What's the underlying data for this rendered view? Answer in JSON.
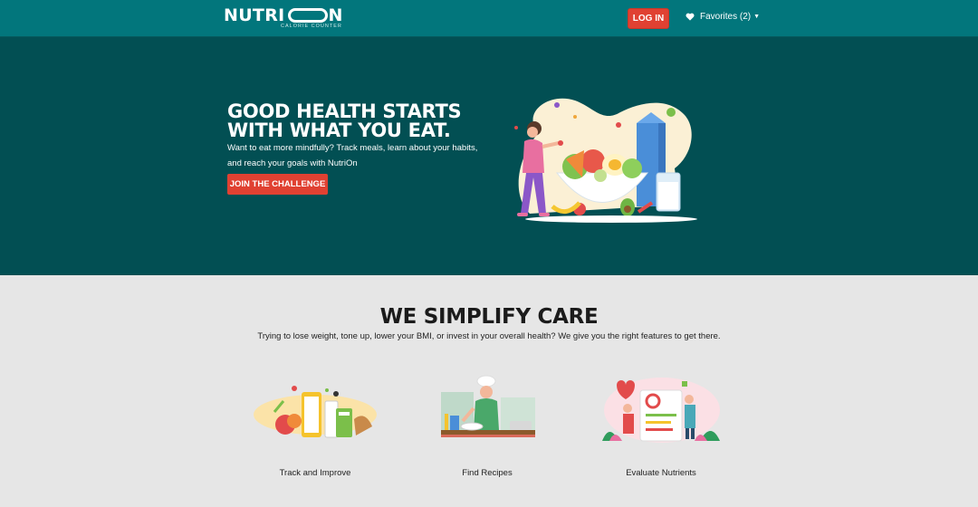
{
  "navbar": {
    "brand": {
      "word_left": "NUTRI",
      "word_right": "N",
      "tagline": "CALORIE COUNTER"
    },
    "login_label": "LOG IN",
    "favorites_label": "Favorites (2)",
    "bg_color": "#02767c",
    "accent_color": "#e04132"
  },
  "hero": {
    "title": "GOOD HEALTH STARTS WITH WHAT YOU EAT.",
    "description": "Want to eat more mindfully? Track meals, learn about your habits, and reach your goals with NutriOn",
    "cta_label": "JOIN THE CHALLENGE",
    "bg_color": "#024f53"
  },
  "features": {
    "title": "WE SIMPLIFY CARE",
    "subtitle": "Trying to lose weight, tone up, lower your BMI, or invest in your overall health? We give you the right features to get there.",
    "items": [
      {
        "label": "Track and Improve",
        "icon": "food-tracking-illustration"
      },
      {
        "label": "Find Recipes",
        "icon": "chef-cooking-illustration"
      },
      {
        "label": "Evaluate Nutrients",
        "icon": "nutrient-checklist-illustration"
      }
    ]
  }
}
